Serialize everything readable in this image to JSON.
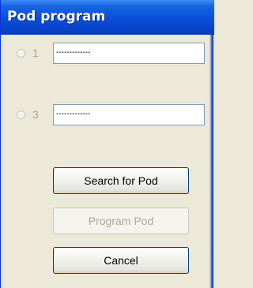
{
  "window": {
    "title": "Pod program"
  },
  "options": [
    {
      "number": "1",
      "value": "-------------"
    },
    {
      "number": "3",
      "value": "-------------"
    }
  ],
  "buttons": {
    "search_label": "Search for Pod",
    "program_label": "Program Pod",
    "cancel_label": "Cancel"
  },
  "colors": {
    "titlebar": "#0a4fd6",
    "face": "#ece9d8",
    "disabled_text": "#aca899"
  }
}
